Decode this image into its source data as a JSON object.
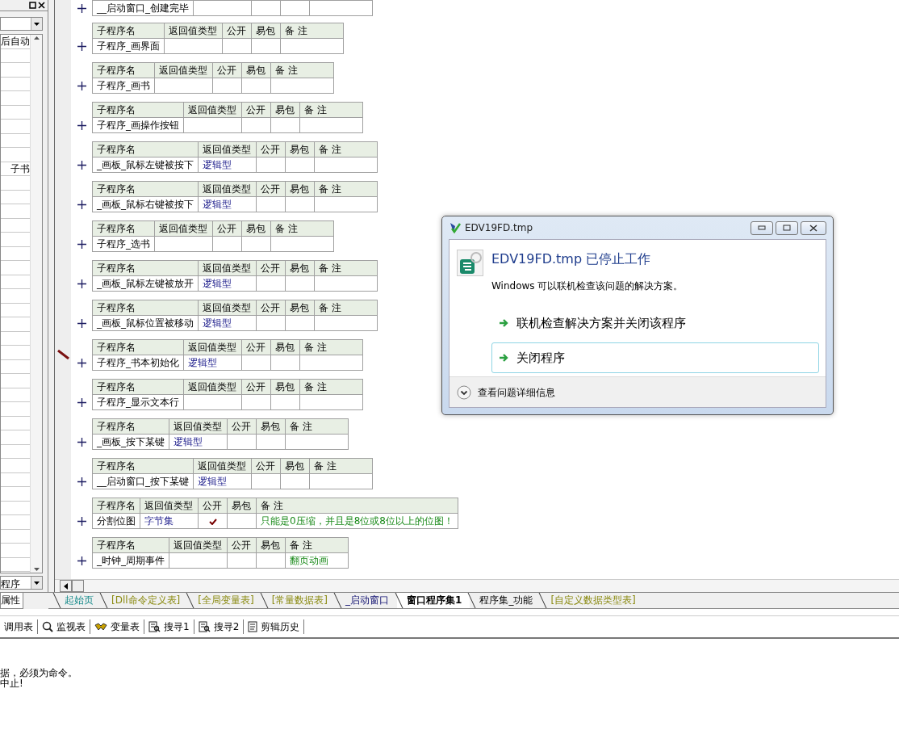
{
  "left_panel": {
    "property_rows": [
      {
        "value": "后自动"
      },
      {
        "value": "子书"
      }
    ],
    "bottom_dropdown": "程序",
    "tab": "属性"
  },
  "procedures": [
    {
      "name": "__启动窗口_创建完毕",
      "public": false,
      "expanded": false,
      "current": false
    },
    {
      "headers": [
        "子程序名",
        "返回值类型",
        "公开",
        "易包",
        "备 注"
      ],
      "name": "子程序_画界面",
      "public": false,
      "expanded": false,
      "current": false
    },
    {
      "headers": [
        "子程序名",
        "返回值类型",
        "公开",
        "易包",
        "备 注"
      ],
      "name": "子程序_画书",
      "public": false,
      "expanded": false,
      "current": false
    },
    {
      "headers": [
        "子程序名",
        "返回值类型",
        "公开",
        "易包",
        "备 注"
      ],
      "name": "子程序_画操作按钮",
      "public": false,
      "expanded": false,
      "current": false
    },
    {
      "headers": [
        "子程序名",
        "返回值类型",
        "公开",
        "易包",
        "备 注"
      ],
      "name": "_画板_鼠标左键被按下",
      "return_type": "逻辑型",
      "public": false,
      "expanded": false,
      "current": false
    },
    {
      "headers": [
        "子程序名",
        "返回值类型",
        "公开",
        "易包",
        "备 注"
      ],
      "name": "_画板_鼠标右键被按下",
      "return_type": "逻辑型",
      "public": false,
      "expanded": false,
      "current": false
    },
    {
      "headers": [
        "子程序名",
        "返回值类型",
        "公开",
        "易包",
        "备 注"
      ],
      "name": "子程序_选书",
      "public": false,
      "expanded": false,
      "current": false
    },
    {
      "headers": [
        "子程序名",
        "返回值类型",
        "公开",
        "易包",
        "备 注"
      ],
      "name": "_画板_鼠标左键被放开",
      "return_type": "逻辑型",
      "public": false,
      "expanded": false,
      "current": false
    },
    {
      "headers": [
        "子程序名",
        "返回值类型",
        "公开",
        "易包",
        "备 注"
      ],
      "name": "_画板_鼠标位置被移动",
      "return_type": "逻辑型",
      "public": false,
      "expanded": false,
      "current": false
    },
    {
      "headers": [
        "子程序名",
        "返回值类型",
        "公开",
        "易包",
        "备 注"
      ],
      "name": "子程序_书本初始化",
      "return_type": "逻辑型",
      "public": false,
      "expanded": false,
      "current": true
    },
    {
      "headers": [
        "子程序名",
        "返回值类型",
        "公开",
        "易包",
        "备 注"
      ],
      "name": "子程序_显示文本行",
      "public": false,
      "expanded": false,
      "current": false
    },
    {
      "headers": [
        "子程序名",
        "返回值类型",
        "公开",
        "易包",
        "备 注"
      ],
      "name": "_画板_按下某键",
      "return_type": "逻辑型",
      "public": false,
      "expanded": false,
      "current": false
    },
    {
      "headers": [
        "子程序名",
        "返回值类型",
        "公开",
        "易包",
        "备 注"
      ],
      "name": "__启动窗口_按下某键",
      "return_type": "逻辑型",
      "public": false,
      "expanded": false,
      "current": false
    },
    {
      "headers": [
        "子程序名",
        "返回值类型",
        "公开",
        "易包",
        "备 注"
      ],
      "name": "分割位图",
      "return_type": "字节集",
      "public": true,
      "remark": "只能是0压缩，并且是8位或8位以上的位图！",
      "expanded": false,
      "current": false
    },
    {
      "headers": [
        "子程序名",
        "返回值类型",
        "公开",
        "易包",
        "备 注"
      ],
      "name": "_时钟_周期事件",
      "public": false,
      "remark": "翻页动画",
      "expanded": false,
      "current": false
    }
  ],
  "editor_tabs": [
    {
      "label": "起始页",
      "kind": "start",
      "selected": false
    },
    {
      "label": "[Dll命令定义表]",
      "kind": "table",
      "selected": false
    },
    {
      "label": "[全局变量表]",
      "kind": "table",
      "selected": false
    },
    {
      "label": "[常量数据表]",
      "kind": "table",
      "selected": false
    },
    {
      "label": "_启动窗口",
      "kind": "window",
      "selected": false
    },
    {
      "label": "窗口程序集1",
      "kind": "class",
      "selected": true
    },
    {
      "label": "程序集_功能",
      "kind": "class",
      "selected": false
    },
    {
      "label": "[自定义数据类型表]",
      "kind": "table",
      "selected": false
    }
  ],
  "bottom_toolbar": [
    {
      "label": "调用表"
    },
    {
      "label": "监视表"
    },
    {
      "label": "变量表"
    },
    {
      "label": "搜寻1"
    },
    {
      "label": "搜寻2"
    },
    {
      "label": "剪辑历史"
    }
  ],
  "output_lines": [
    "据，必须为命令。",
    "中止!"
  ],
  "dialog": {
    "title": "EDV19FD.tmp",
    "heading": "EDV19FD.tmp 已停止工作",
    "message": "Windows 可以联机检查该问题的解决方案。",
    "options": [
      {
        "label": "联机检查解决方案并关闭该程序",
        "selected": false
      },
      {
        "label": "关闭程序",
        "selected": true
      }
    ],
    "details": "查看问题详细信息"
  }
}
